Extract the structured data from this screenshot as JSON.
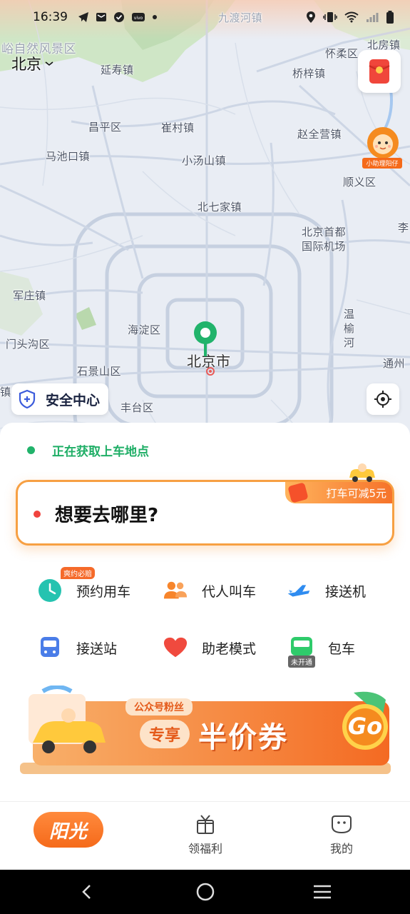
{
  "status_bar": {
    "time": "16:39"
  },
  "city": {
    "name": "北京",
    "chevron": "chevron-down-icon"
  },
  "map": {
    "labels": {
      "scenic_area": "峪自然风景区",
      "jiuduhe": "九渡河镇",
      "huairou": "怀柔区",
      "beifang": "北房镇",
      "yanshou": "延寿镇",
      "qiaozi": "桥梓镇",
      "changping": "昌平区",
      "cuicun": "崔村镇",
      "zhaoquanying": "赵全营镇",
      "machikou": "马池口镇",
      "xiaotangshan": "小汤山镇",
      "shunyi": "顺义区",
      "beiqijia": "北七家镇",
      "airport_line1": "北京首都",
      "airport_line2": "国际机场",
      "li": "李",
      "junzhuang": "军庄镇",
      "wenyu": "温榆河",
      "haidian": "海淀区",
      "mentougou": "门头沟区",
      "beijing_city": "北京市",
      "tongzhou": "通州",
      "shijingshan": "石景山区",
      "zhen": "镇",
      "fengtai": "丰台区"
    }
  },
  "red_envelope": {
    "icon": "red-envelope-icon"
  },
  "assistant": {
    "tag": "小助理阳仔"
  },
  "safety": {
    "label": "安全中心",
    "icon": "shield-plus-icon"
  },
  "locate": {
    "icon": "locate-icon"
  },
  "pickup": {
    "status": "正在获取上车地点"
  },
  "destination": {
    "placeholder": "想要去哪里?",
    "promo": "打车可减5元"
  },
  "services": [
    {
      "label": "预约用车",
      "icon": "clock-icon",
      "badge": "爽约必赔"
    },
    {
      "label": "代人叫车",
      "icon": "people-icon",
      "badge": ""
    },
    {
      "label": "接送机",
      "icon": "airplane-icon",
      "badge": ""
    },
    {
      "label": "接送站",
      "icon": "train-icon",
      "badge": ""
    },
    {
      "label": "助老模式",
      "icon": "heart-icon",
      "badge": ""
    },
    {
      "label": "包车",
      "icon": "bus-icon",
      "badge": "未开通"
    }
  ],
  "banner": {
    "fans_tag": "公众号粉丝",
    "exclusive": "专享",
    "title": "半价券",
    "go": "Go"
  },
  "tabs": {
    "home": "阳光",
    "welfare": "领福利",
    "mine": "我的"
  },
  "colors": {
    "accent": "#f56a1a",
    "green": "#21b36b",
    "map_bg": "#e9edf4"
  }
}
